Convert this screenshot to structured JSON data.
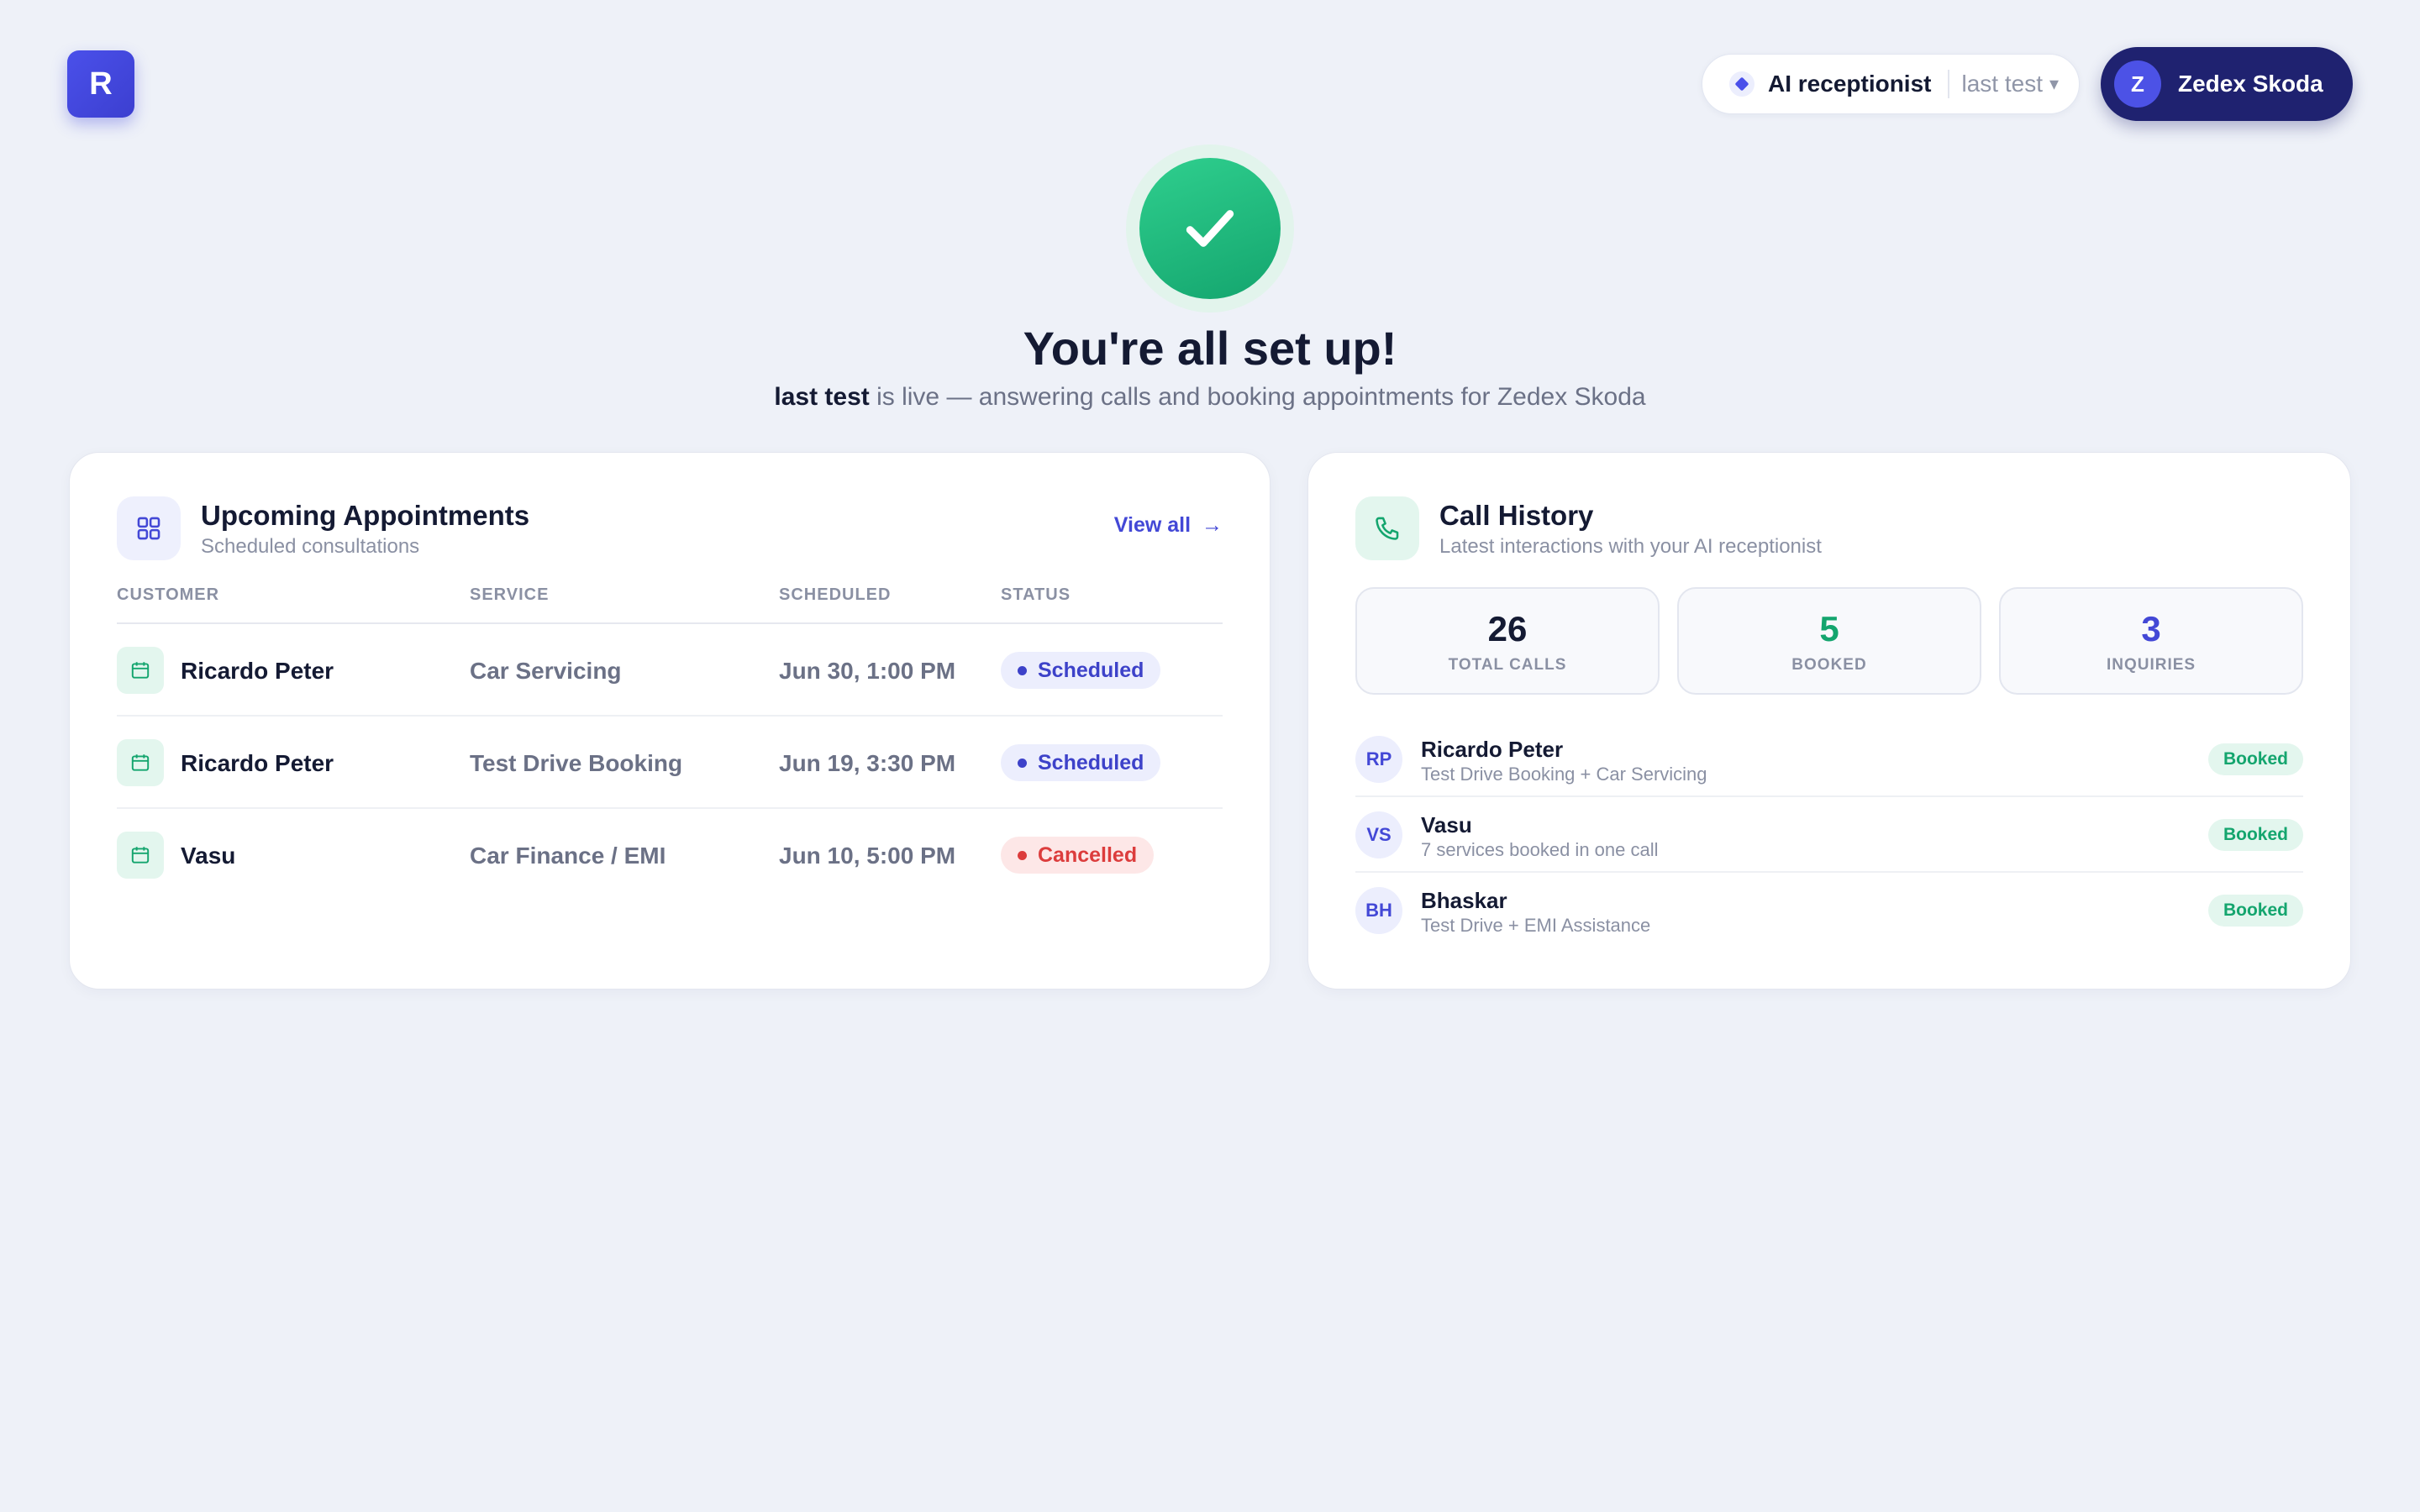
{
  "app": {
    "logo_letter": "R"
  },
  "header": {
    "agent_label": "AI receptionist",
    "agent_name": "last test",
    "user_initial": "Z",
    "user_name": "Zedex Skoda"
  },
  "hero": {
    "title": "You're all set up!",
    "agent_name": "last test",
    "subtitle_rest": " is live — answering calls and booking appointments for Zedex Skoda"
  },
  "appointments": {
    "title": "Upcoming Appointments",
    "subtitle": "Scheduled consultations",
    "view_all_label": "View all",
    "view_all_arrow": "→",
    "columns": [
      "CUSTOMER",
      "SERVICE",
      "SCHEDULED",
      "STATUS"
    ],
    "rows": [
      {
        "customer": "Ricardo Peter",
        "service": "Car Servicing",
        "scheduled": "Jun 30, 1:00 PM",
        "status": "Scheduled"
      },
      {
        "customer": "Ricardo Peter",
        "service": "Test Drive Booking",
        "scheduled": "Jun 19, 3:30 PM",
        "status": "Scheduled"
      },
      {
        "customer": "Vasu",
        "service": "Car Finance / EMI",
        "scheduled": "Jun 10, 5:00 PM",
        "status": "Cancelled"
      }
    ]
  },
  "calls": {
    "title": "Call History",
    "subtitle": "Latest interactions with your AI receptionist",
    "stats": [
      {
        "value": "26",
        "label": "TOTAL CALLS",
        "color": "#141a33"
      },
      {
        "value": "5",
        "label": "BOOKED",
        "color": "#14a56e"
      },
      {
        "value": "3",
        "label": "INQUIRIES",
        "color": "#4348d6"
      }
    ],
    "items": [
      {
        "initials": "RP",
        "name": "Ricardo Peter",
        "desc": "Test Drive Booking + Car Servicing",
        "badge": "Booked"
      },
      {
        "initials": "VS",
        "name": "Vasu",
        "desc": "7 services booked in one call",
        "badge": "Booked"
      },
      {
        "initials": "BH",
        "name": "Bhaskar",
        "desc": "Test Drive + EMI Assistance",
        "badge": "Booked"
      }
    ]
  },
  "colors": {
    "brand": "#4a50ea",
    "navy": "#1f2270",
    "success": "#14a56e",
    "danger": "#dc3c3c",
    "background": "#eef1f8"
  },
  "icons": {
    "agent": "diamond-icon",
    "success": "checkmark-icon",
    "appointments": "grid-icon",
    "calls": "phone-icon",
    "row": "calendar-icon"
  }
}
